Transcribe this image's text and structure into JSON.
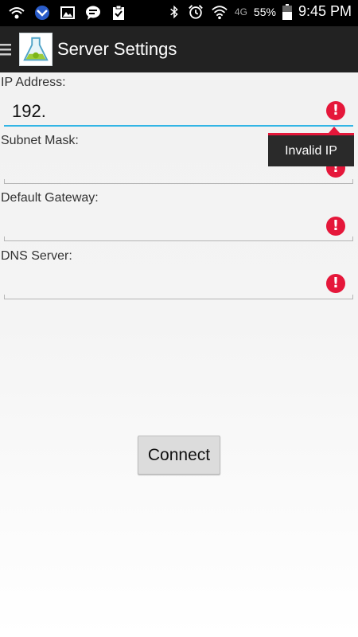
{
  "status_bar": {
    "left_icons": [
      "wifi-hotspot-icon",
      "missed-call-icon",
      "image-icon",
      "chat-icon",
      "clipboard-check-icon"
    ],
    "right_icons": [
      "bluetooth-icon",
      "alarm-icon",
      "wifi-icon"
    ],
    "network": "4G",
    "battery": "55%",
    "time": "9:45 PM"
  },
  "action_bar": {
    "title": "Server Settings",
    "menu_icon": "hamburger-icon",
    "logo_icon": "android-flask-logo"
  },
  "form": {
    "ip": {
      "label": "IP Address:",
      "value": "192.",
      "error": "Invalid IP"
    },
    "subnet": {
      "label": "Subnet Mask:",
      "value": ""
    },
    "gateway": {
      "label": "Default Gateway:",
      "value": ""
    },
    "dns": {
      "label": "DNS Server:",
      "value": ""
    }
  },
  "buttons": {
    "connect": "Connect"
  },
  "colors": {
    "accent": "#33b5e5",
    "error": "#e5173a",
    "action_bar": "#222222"
  }
}
